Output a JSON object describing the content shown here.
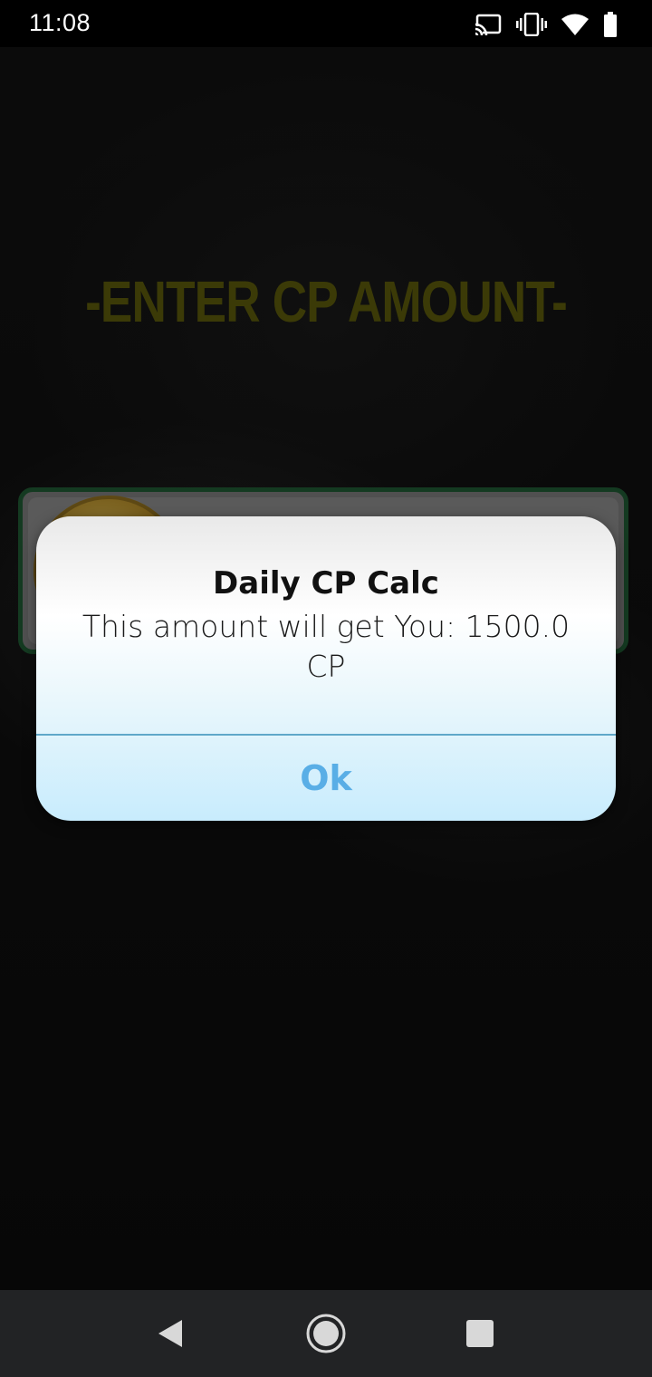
{
  "status_bar": {
    "time": "11:08",
    "icons": [
      "cast-icon",
      "vibrate-icon",
      "wifi-icon",
      "battery-icon"
    ]
  },
  "screen": {
    "heading": "-ENTER CP AMOUNT-"
  },
  "dialog": {
    "title": "Daily CP Calc",
    "message": "This amount will get You: 1500.0 CP",
    "ok_label": "Ok"
  },
  "nav_bar": {
    "icons": [
      "back-icon",
      "home-icon",
      "recents-icon"
    ]
  },
  "colors": {
    "heading": "#5b5a0b",
    "input_border": "#1f5a33",
    "ok_text": "#59aee6",
    "divider": "#5fa8c9",
    "nav_bar": "#222325"
  }
}
